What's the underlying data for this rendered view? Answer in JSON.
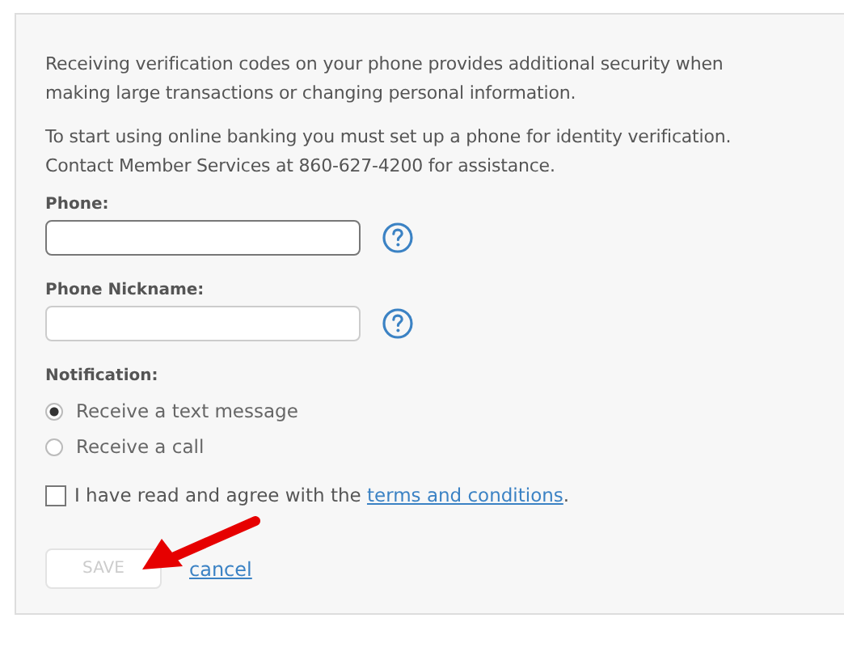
{
  "intro": [
    "Receiving verification codes on your phone provides additional security when making large transactions or changing personal information.",
    "To start using online banking you must set up a phone for identity verification. Contact Member Services at 860-627-4200 for assistance."
  ],
  "fields": [
    {
      "label": "Phone:",
      "help": true,
      "focused": true
    },
    {
      "label": "Phone Nickname:",
      "help": true,
      "focused": false
    }
  ],
  "notification": {
    "label": "Notification:",
    "options": [
      {
        "label": "Receive a text message",
        "selected": true
      },
      {
        "label": "Receive a call",
        "selected": false
      }
    ]
  },
  "agree": {
    "checked": false,
    "text_before": "I have read and agree with the ",
    "link": "terms and conditions",
    "text_after": "."
  },
  "save": {
    "label": "SAVE",
    "disabled": true
  },
  "cancel": "cancel"
}
